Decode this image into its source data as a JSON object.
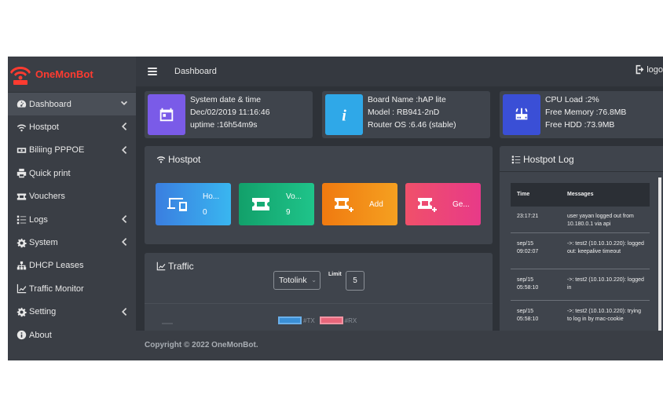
{
  "brand": {
    "name": "OneMonBot",
    "color": "#ff3b30"
  },
  "sidebar": {
    "items": [
      {
        "label": "Dashboard",
        "icon": "dashboard-icon",
        "caret": "down",
        "active": true
      },
      {
        "label": "Hostpot",
        "icon": "wifi-icon",
        "caret": "left"
      },
      {
        "label": "Biliing PPPOE",
        "icon": "money-icon",
        "caret": "left"
      },
      {
        "label": "Quick print",
        "icon": "print-icon",
        "caret": ""
      },
      {
        "label": "Vouchers",
        "icon": "ticket-icon",
        "caret": ""
      },
      {
        "label": "Logs",
        "icon": "list-icon",
        "caret": "left"
      },
      {
        "label": "System",
        "icon": "gear-icon",
        "caret": "left"
      },
      {
        "label": "DHCP Leases",
        "icon": "sitemap-icon",
        "caret": ""
      },
      {
        "label": "Traffic Monitor",
        "icon": "chart-icon",
        "caret": ""
      },
      {
        "label": "Setting",
        "icon": "cog-icon",
        "caret": "left"
      },
      {
        "label": "About",
        "icon": "info-icon",
        "caret": ""
      }
    ]
  },
  "topbar": {
    "title": "Dashboard",
    "logout_label": "logo"
  },
  "info_boxes": [
    {
      "icon": "calendar-icon",
      "color": "#7a5be8",
      "lines": [
        "System date & time",
        "Dec/02/2019 11:16:46",
        "uptime :16h54m9s"
      ]
    },
    {
      "icon": "info-icon",
      "color": "#2fa8e8",
      "lines": [
        "Board Name :hAP lite",
        "Model : RB941-2nD",
        "Router OS :6.46 (stable)"
      ]
    },
    {
      "icon": "router-icon",
      "color": "#3a4fd6",
      "lines": [
        "CPU Load :2%",
        "Free Memory :76.8MB",
        "Free HDD :73.9MB"
      ]
    }
  ],
  "hostpot": {
    "title": "Hostpot",
    "tiles": [
      {
        "label": "Ho...",
        "count": "0",
        "icon": "devices-icon"
      },
      {
        "label": "Vo...",
        "count": "9",
        "icon": "ticket-icon"
      },
      {
        "label": "Add",
        "count": "",
        "icon": "ticket-add-icon"
      },
      {
        "label": "Ge...",
        "count": "",
        "icon": "ticket-add-icon"
      }
    ]
  },
  "traffic": {
    "title": "Traffic",
    "interface": "Totolink",
    "limit_label": "Limit",
    "limit_value": "5",
    "legend": [
      {
        "name": "#TX",
        "color": "#3a8fd6"
      },
      {
        "name": "#RX",
        "color": "#e8657a"
      }
    ]
  },
  "hostpot_log": {
    "title": "Hostpot Log",
    "headers": {
      "time": "Time",
      "messages": "Messages"
    },
    "rows": [
      {
        "time": "23:17:21",
        "message": "user yayan logged out from 10.180.0.1 via api"
      },
      {
        "time": "sep/15 09:02:07",
        "message": "->: test2 (10.10.10.220): logged out: keepalive timeout"
      },
      {
        "time": "sep/15 05:58:10",
        "message": "->: test2 (10.10.10.220): logged in"
      },
      {
        "time": "sep/15 05:58:10",
        "message": "->: test2 (10.10.10.220): trying to log in by mac-cookie"
      }
    ]
  },
  "footer": {
    "text": "Copyright © 2022 OneMonBot."
  }
}
